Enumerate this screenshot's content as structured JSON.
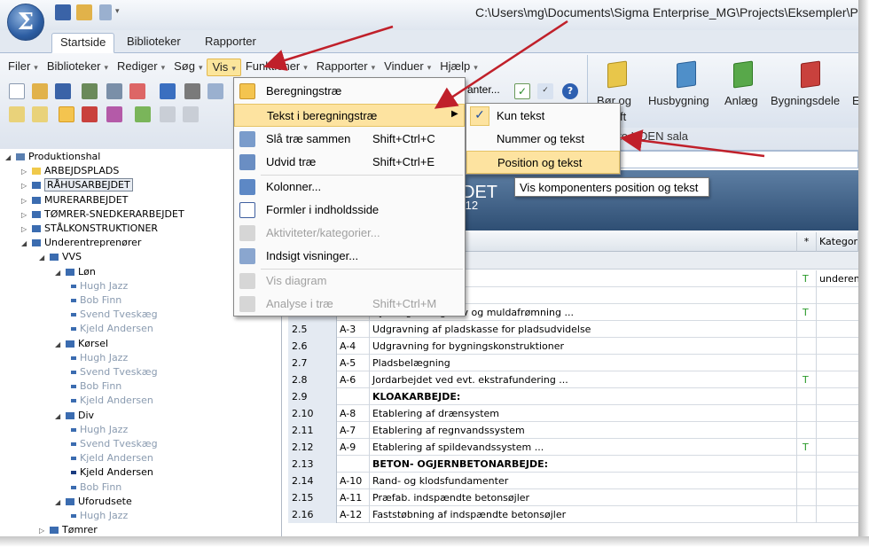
{
  "window": {
    "path": "C:\\Users\\mg\\Documents\\Sigma Enterprise_MG\\Projects\\Eksempler\\Produ"
  },
  "app_logo": "Σ",
  "ribbon_tabs": [
    "Startside",
    "Biblioteker",
    "Rapporter"
  ],
  "menubar": [
    "Filer",
    "Biblioteker",
    "Rediger",
    "Søg",
    "Vis",
    "Funktioner",
    "Rapporter",
    "Vinduer",
    "Hjælp"
  ],
  "ribbon_group": {
    "partial_label": "anter...",
    "books": [
      {
        "label": "Bør og",
        "label2": "ft",
        "color": "#e8c64a"
      },
      {
        "label": "Husbygning",
        "color": "#4f8fc9"
      },
      {
        "label": "Anlæg",
        "color": "#58a84a"
      },
      {
        "label": "Bygningsdele",
        "color": "#c9413d"
      },
      {
        "label": "E",
        "color": "#e8c64a"
      }
    ]
  },
  "info_text": "/Standard V&S pristype: Brutto UDEN sala",
  "dropdown": {
    "items": [
      {
        "label": "Beregningstræ",
        "shortcut": "",
        "disabled": false,
        "icon": "tree-icon"
      },
      {
        "label": "Tekst i beregningstræ",
        "shortcut": "",
        "disabled": false,
        "icon": "submenu-arrow"
      },
      {
        "label": "Slå træ sammen",
        "shortcut": "Shift+Ctrl+C",
        "disabled": false,
        "icon": "collapse-icon"
      },
      {
        "label": "Udvid træ",
        "shortcut": "Shift+Ctrl+E",
        "disabled": false,
        "icon": "expand-icon"
      },
      {
        "label": "Kolonner...",
        "shortcut": "",
        "disabled": false,
        "icon": "columns-icon"
      },
      {
        "label": "Formler i indholdsside",
        "shortcut": "",
        "disabled": false,
        "icon": "formula-icon"
      },
      {
        "label": "Aktiviteter/kategorier...",
        "shortcut": "",
        "disabled": true,
        "icon": "activity-icon"
      },
      {
        "label": "Indsigt visninger...",
        "shortcut": "",
        "disabled": false,
        "icon": "insight-icon"
      },
      {
        "label": "Vis diagram",
        "shortcut": "",
        "disabled": true,
        "icon": "diagram-icon"
      },
      {
        "label": "Analyse i træ",
        "shortcut": "Shift+Ctrl+M",
        "disabled": true,
        "icon": "analysis-icon"
      }
    ]
  },
  "submenu": {
    "items": [
      {
        "label": "Kun tekst",
        "checked": true
      },
      {
        "label": "Nummer og tekst",
        "checked": false
      },
      {
        "label": "Position og tekst",
        "checked": false
      }
    ],
    "check_glyph": "✓"
  },
  "tooltip": "Vis komponenters position og tekst",
  "banner": {
    "title_partial": "DET",
    "sub_partial": ".12"
  },
  "grid_headers": {
    "star": "*",
    "kategori": "Kategori"
  },
  "tree": [
    {
      "label": "Produktionshal",
      "level": 0,
      "type": "root"
    },
    {
      "label": "ARBEJDSPLADS",
      "level": 1,
      "type": "folder"
    },
    {
      "label": "RÅHUSARBEJDET",
      "level": 1,
      "type": "group",
      "selected": true
    },
    {
      "label": "MURERARBEJDET",
      "level": 1,
      "type": "group"
    },
    {
      "label": "TØMRER-SNEDKERARBEJDET",
      "level": 1,
      "type": "group"
    },
    {
      "label": "STÅLKONSTRUKTIONER",
      "level": 1,
      "type": "group"
    },
    {
      "label": "Underentreprenører",
      "level": 1,
      "type": "group"
    },
    {
      "label": "VVS",
      "level": 2,
      "type": "group"
    },
    {
      "label": "Løn",
      "level": 3,
      "type": "group"
    },
    {
      "label": "Hugh Jazz",
      "level": 4,
      "type": "leaf"
    },
    {
      "label": "Bob Finn",
      "level": 4,
      "type": "leaf"
    },
    {
      "label": "Svend Tveskæg",
      "level": 4,
      "type": "leaf"
    },
    {
      "label": "Kjeld Andersen",
      "level": 4,
      "type": "leaf"
    },
    {
      "label": "Kørsel",
      "level": 3,
      "type": "group"
    },
    {
      "label": "Hugh Jazz",
      "level": 4,
      "type": "leaf"
    },
    {
      "label": "Svend Tveskæg",
      "level": 4,
      "type": "leaf"
    },
    {
      "label": "Bob Finn",
      "level": 4,
      "type": "leaf"
    },
    {
      "label": "Kjeld Andersen",
      "level": 4,
      "type": "leaf"
    },
    {
      "label": "Div",
      "level": 3,
      "type": "group"
    },
    {
      "label": "Hugh Jazz",
      "level": 4,
      "type": "leaf"
    },
    {
      "label": "Svend Tveskæg",
      "level": 4,
      "type": "leaf"
    },
    {
      "label": "Kjeld Andersen",
      "level": 4,
      "type": "leaf"
    },
    {
      "label": "Kjeld Andersen",
      "level": 4,
      "type": "leafdark"
    },
    {
      "label": "Bob Finn",
      "level": 4,
      "type": "leaf"
    },
    {
      "label": "Uforudsete",
      "level": 3,
      "type": "group"
    },
    {
      "label": "Hugh Jazz",
      "level": 4,
      "type": "leaf"
    },
    {
      "label": "Tømrer",
      "level": 2,
      "type": "group"
    }
  ],
  "grid_rows": [
    {
      "nr": "",
      "pos": "",
      "text": "et ...",
      "t": "T",
      "kat": "underent",
      "bold": false
    },
    {
      "nr": "",
      "pos": "",
      "text": "",
      "t": "",
      "kat": "",
      "bold": false
    },
    {
      "nr": "2.4",
      "pos": "A-2",
      "text": "Rydning af ungskov og muldafrømning ...",
      "t": "T",
      "kat": "",
      "bold": false
    },
    {
      "nr": "2.5",
      "pos": "A-3",
      "text": "Udgravning af pladskasse for pladsudvidelse",
      "t": "",
      "kat": "",
      "bold": false
    },
    {
      "nr": "2.6",
      "pos": "A-4",
      "text": "Udgravning for bygningskonstruktioner",
      "t": "",
      "kat": "",
      "bold": false
    },
    {
      "nr": "2.7",
      "pos": "A-5",
      "text": "Pladsbelægning",
      "t": "",
      "kat": "",
      "bold": false
    },
    {
      "nr": "2.8",
      "pos": "A-6",
      "text": "Jordarbejdet ved evt. ekstrafundering ...",
      "t": "T",
      "kat": "",
      "bold": false
    },
    {
      "nr": "2.9",
      "pos": "",
      "text": "KLOAKARBEJDE:",
      "t": "",
      "kat": "",
      "bold": true
    },
    {
      "nr": "2.10",
      "pos": "A-8",
      "text": "Etablering af drænsystem",
      "t": "",
      "kat": "",
      "bold": false
    },
    {
      "nr": "2.11",
      "pos": "A-7",
      "text": "Etablering af regnvandssystem",
      "t": "",
      "kat": "",
      "bold": false
    },
    {
      "nr": "2.12",
      "pos": "A-9",
      "text": "Etablering af spildevandssystem ...",
      "t": "T",
      "kat": "",
      "bold": false
    },
    {
      "nr": "2.13",
      "pos": "",
      "text": "BETON- OGJERNBETONARBEJDE:",
      "t": "",
      "kat": "",
      "bold": true
    },
    {
      "nr": "2.14",
      "pos": "A-10",
      "text": "Rand- og klodsfundamenter",
      "t": "",
      "kat": "",
      "bold": false
    },
    {
      "nr": "2.15",
      "pos": "A-11",
      "text": "Præfab. indspændte betonsøjler",
      "t": "",
      "kat": "",
      "bold": false
    },
    {
      "nr": "2.16",
      "pos": "A-12",
      "text": "Faststøbning af indspændte betonsøjler",
      "t": "",
      "kat": "",
      "bold": false
    }
  ],
  "colors": {
    "accent": "#fde3a0",
    "arrow": "#c0202a",
    "banner": "#3d5f86"
  }
}
